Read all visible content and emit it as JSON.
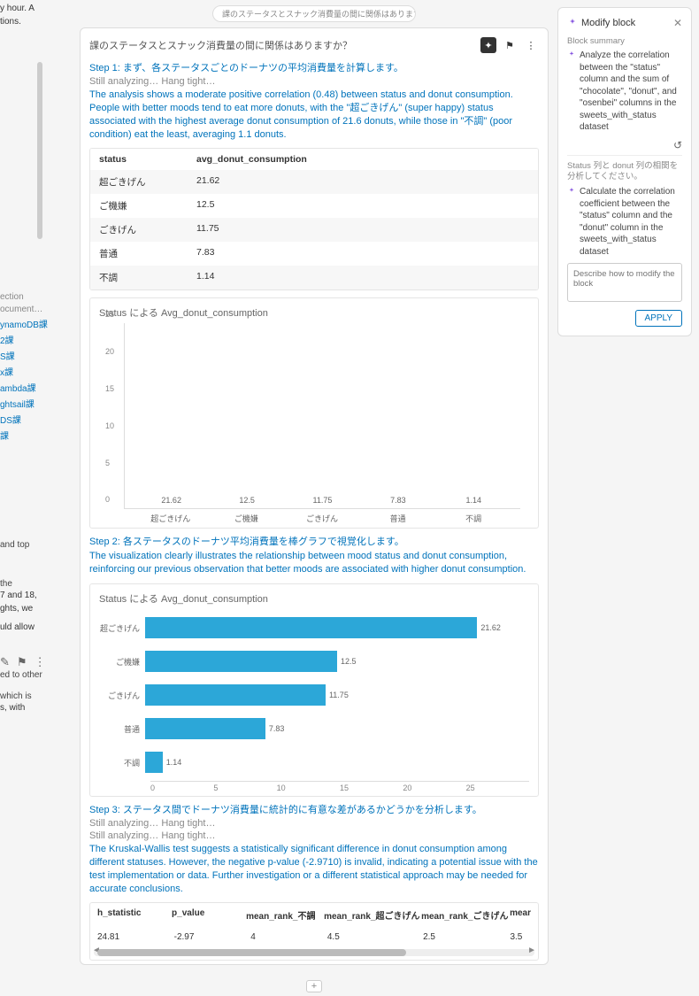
{
  "left": {
    "frag1": "y hour. A",
    "frag2": "tions.",
    "sectionLabel": "ection",
    "items": [
      {
        "label": "ocument…",
        "gray": true
      },
      {
        "label": "ynamoDB課"
      },
      {
        "label": "2課"
      },
      {
        "label": "S課"
      },
      {
        "label": "x課"
      },
      {
        "label": "ambda課"
      },
      {
        "label": "ghtsail課"
      },
      {
        "label": "DS課"
      },
      {
        "label": "課"
      }
    ],
    "para1": "and top",
    "para2": "the",
    "para3": "7 and 18,",
    "para4": "ghts, we",
    "para5": "uld allow",
    "para6": "ed to other",
    "para7": "which is",
    "para8": "s, with"
  },
  "miniBar": "課のステータスとスナック消費量の間に関係はありますか？",
  "card": {
    "title": "課のステータスとスナック消費量の間に関係はありますか？",
    "step1": "Step 1: まず、各ステータスごとのドーナツの平均消費量を計算します。",
    "analyzing": "Still analyzing… Hang tight…",
    "body1": "The analysis shows a moderate positive correlation (0.48) between status and donut consumption. People with better moods tend to eat more donuts, with the \"超ごきげん\" (super happy) status associated with the highest average donut consumption of 21.6 donuts, while those in \"不調\" (poor condition) eat the least, averaging 1.1 donuts.",
    "table1": {
      "headers": [
        "status",
        "avg_donut_consumption"
      ],
      "rows": [
        [
          "超ごきげん",
          "21.62"
        ],
        [
          "ご機嫌",
          "12.5"
        ],
        [
          "ごきげん",
          "11.75"
        ],
        [
          "普通",
          "7.83"
        ],
        [
          "不調",
          "1.14"
        ]
      ]
    },
    "chartTitle": "Status による Avg_donut_consumption",
    "step2": "Step 2: 各ステータスのドーナツ平均消費量を棒グラフで視覚化します。",
    "body2": "The visualization clearly illustrates the relationship between mood status and donut consumption, reinforcing our previous observation that better moods are associated with higher donut consumption.",
    "step3": "Step 3: ステータス間でドーナツ消費量に統計的に有意な差があるかどうかを分析します。",
    "body3": "The Kruskal-Wallis test suggests a statistically significant difference in donut consumption among different statuses. However, the negative p-value (-2.9710) is invalid, indicating a potential issue with the test implementation or data. Further investigation or a different statistical approach may be needed for accurate conclusions.",
    "statsTable": {
      "headers": [
        "h_statistic",
        "p_value",
        "mean_rank_不調",
        "mean_rank_超ごきげん",
        "mean_rank_ごきげん",
        "mear"
      ],
      "row": [
        "24.81",
        "-2.97",
        "4",
        "4.5",
        "2.5",
        "3.5"
      ]
    }
  },
  "chart_data": [
    {
      "type": "bar",
      "orientation": "vertical",
      "title": "Status による Avg_donut_consumption",
      "categories": [
        "超ごきげん",
        "ご機嫌",
        "ごきげん",
        "普通",
        "不調"
      ],
      "values": [
        21.62,
        12.5,
        11.75,
        7.83,
        1.14
      ],
      "ylim": [
        0,
        25
      ],
      "yticks": [
        0,
        5,
        10,
        15,
        20,
        25
      ]
    },
    {
      "type": "bar",
      "orientation": "horizontal",
      "title": "Status による Avg_donut_consumption",
      "categories": [
        "超ごきげん",
        "ご機嫌",
        "ごきげん",
        "普通",
        "不調"
      ],
      "values": [
        21.62,
        12.5,
        11.75,
        7.83,
        1.14
      ],
      "xlim": [
        0,
        25
      ],
      "xticks": [
        0,
        5,
        10,
        15,
        20,
        25
      ]
    }
  ],
  "modify": {
    "title": "Modify block",
    "summaryLabel": "Block summary",
    "summary1": "Analyze the correlation between the \"status\" column and the sum of \"chocolate\", \"donut\", and \"osenbei\" columns in the sweets_with_status dataset",
    "userPrompt": "Status 列と donut 列の相関を分析してください。",
    "summary2": "Calculate the correlation coefficient between the \"status\" column and the \"donut\" column in the sweets_with_status dataset",
    "placeholder": "Describe how to modify the block",
    "apply": "APPLY"
  }
}
